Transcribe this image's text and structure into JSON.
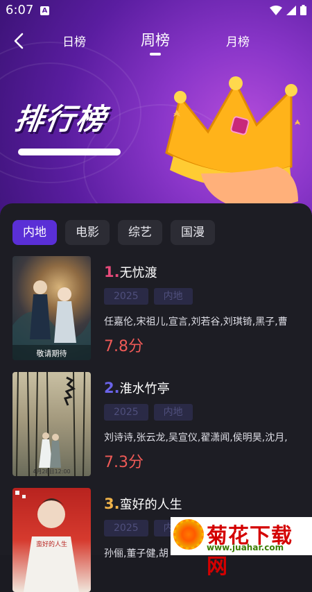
{
  "status_bar": {
    "time": "6:07",
    "notification_letter": "A"
  },
  "nav": {
    "tabs": [
      {
        "label": "日榜",
        "active": false
      },
      {
        "label": "周榜",
        "active": true
      },
      {
        "label": "月榜",
        "active": false
      }
    ]
  },
  "banner": {
    "title": "排行榜"
  },
  "categories": [
    {
      "label": "内地",
      "active": true
    },
    {
      "label": "电影",
      "active": false
    },
    {
      "label": "综艺",
      "active": false
    },
    {
      "label": "国漫",
      "active": false
    }
  ],
  "rankings": [
    {
      "rank": "1.",
      "title": "无忧渡",
      "year": "2025",
      "region": "内地",
      "cast": "任嘉伦,宋祖儿,宣言,刘若谷,刘琪锜,黑子,曹",
      "score": "7.8分",
      "rank_color": "#e64a7a",
      "poster_caption": "敬请期待"
    },
    {
      "rank": "2.",
      "title": "淮水竹亭",
      "year": "2025",
      "region": "内地",
      "cast": "刘诗诗,张云龙,吴宣仪,翟潇闻,侯明昊,沈月,",
      "score": "7.3分",
      "rank_color": "#6a63e8",
      "poster_caption": "4月28日12:00"
    },
    {
      "rank": "3.",
      "title": "蛮好的人生",
      "year": "2025",
      "region": "内地",
      "cast": "孙俪,董子健,胡",
      "score": "",
      "rank_color": "#f0b34a",
      "poster_caption": "蛮好的人生"
    }
  ],
  "watermark": {
    "name": "菊花下载网",
    "url": "www.juahar.com"
  },
  "colors": {
    "accent": "#5a2fd6",
    "score": "#ef5a57",
    "hero": "#6a24b0"
  }
}
